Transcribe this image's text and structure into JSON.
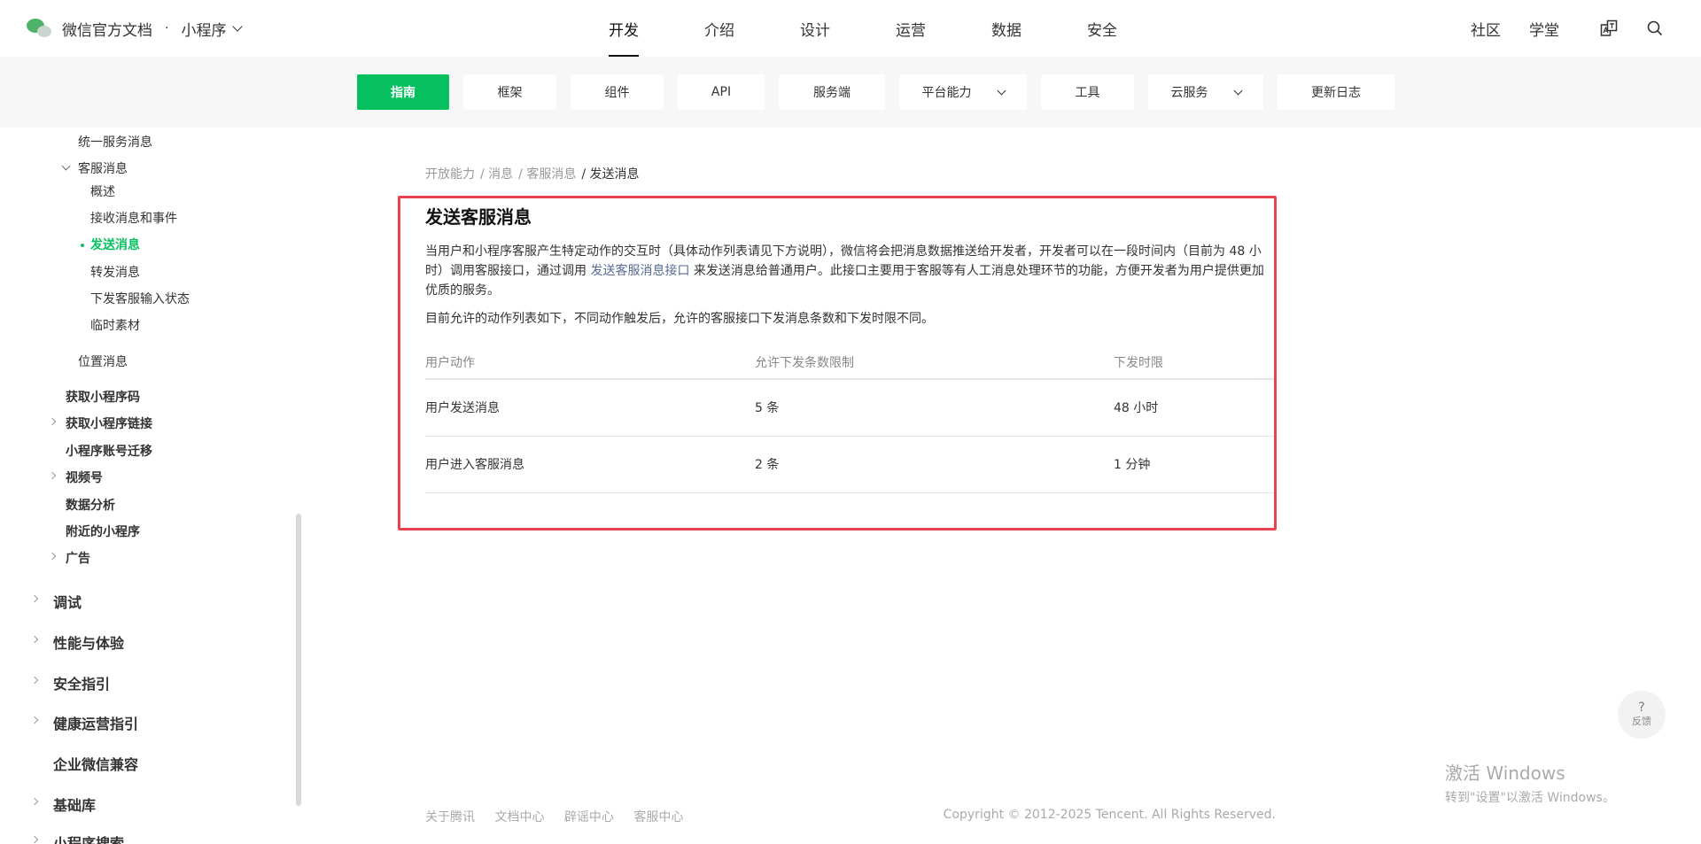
{
  "header": {
    "brand_title": "微信官方文档",
    "brand_dot": "·",
    "brand_sub": "小程序",
    "nav": [
      "开发",
      "介绍",
      "设计",
      "运营",
      "数据",
      "安全"
    ],
    "right_links": [
      "社区",
      "学堂"
    ]
  },
  "subnav": {
    "items": [
      "指南",
      "框架",
      "组件",
      "API",
      "服务端",
      "平台能力",
      "工具",
      "云服务",
      "更新日志"
    ]
  },
  "sidebar": {
    "items": [
      "统一服务消息",
      "客服消息",
      "概述",
      "接收消息和事件",
      "发送消息",
      "转发消息",
      "下发客服输入状态",
      "临时素材",
      "位置消息",
      "获取小程序码",
      "获取小程序链接",
      "小程序账号迁移",
      "视频号",
      "数据分析",
      "附近的小程序",
      "广告",
      "调试",
      "性能与体验",
      "安全指引",
      "健康运营指引",
      "企业微信兼容",
      "基础库",
      "小程序搜索"
    ]
  },
  "breadcrumb": [
    "开放能力",
    "/ 消息",
    "/ 客服消息",
    "/ 发送消息"
  ],
  "content": {
    "title": "发送客服消息",
    "para1_a": "当用户和小程序客服产生特定动作的交互时（具体动作列表请见下方说明），微信将会把消息数据推送给开发者，开发者可以在一段时间内（目前为 48 小时）调用客服接口，通过调用 ",
    "para1_link": "发送客服消息接口",
    "para1_b": " 来发送消息给普通用户。此接口主要用于客服等有人工消息处理环节的功能，方便开发者为用户提供更加优质的服务。",
    "para2": "目前允许的动作列表如下，不同动作触发后，允许的客服接口下发消息条数和下发时限不同。",
    "table": {
      "headers": [
        "用户动作",
        "允许下发条数限制",
        "下发时限"
      ],
      "rows": [
        [
          "用户发送消息",
          "5 条",
          "48 小时"
        ],
        [
          "用户进入客服消息",
          "2 条",
          "1 分钟"
        ]
      ]
    }
  },
  "footer": {
    "links": [
      "关于腾讯",
      "文档中心",
      "辟谣中心",
      "客服中心"
    ],
    "copyright": "Copyright © 2012-2025 Tencent. All Rights Reserved."
  },
  "feedback": {
    "icon": "?",
    "label": "反馈"
  },
  "watermark": {
    "line1": "激活 Windows",
    "line2": "转到\"设置\"以激活 Windows。"
  },
  "colors": {
    "accent": "#07c160",
    "highlight": "#e9434f",
    "link": "#576b95"
  }
}
